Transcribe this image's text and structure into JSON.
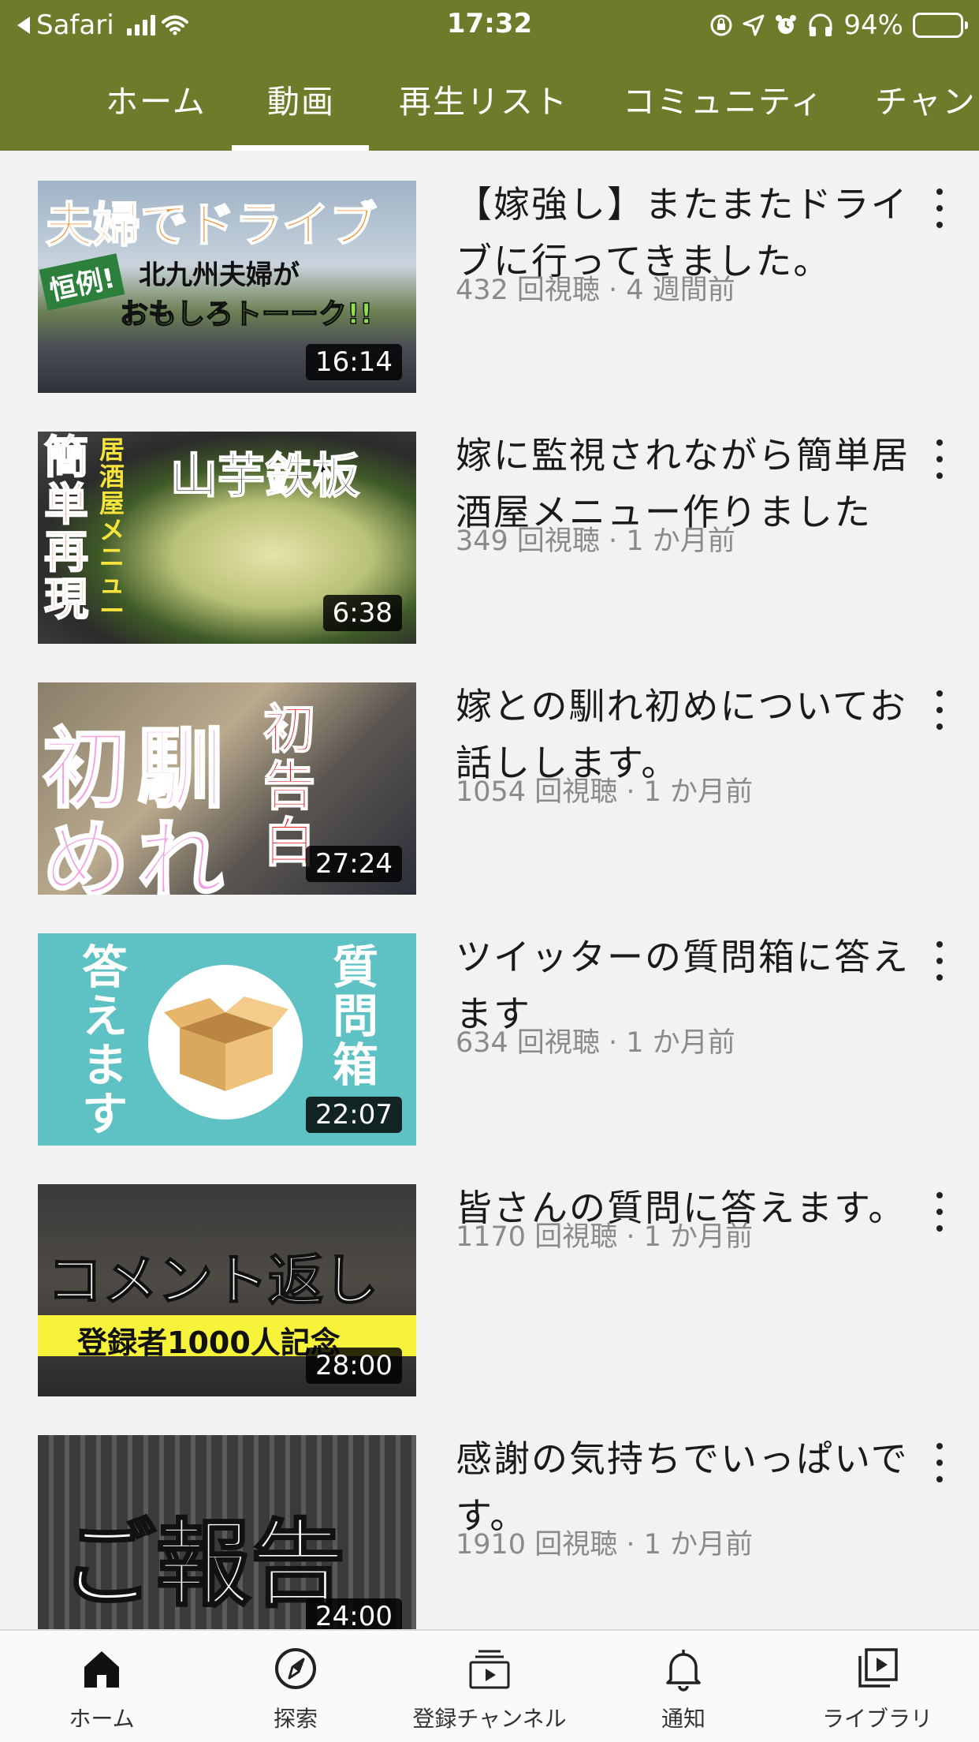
{
  "status_bar": {
    "back_app": "Safari",
    "time": "17:32",
    "battery": "94%"
  },
  "tabs": [
    {
      "label": "ホーム"
    },
    {
      "label": "動画"
    },
    {
      "label": "再生リスト"
    },
    {
      "label": "コミュニティ"
    },
    {
      "label": "チャン"
    }
  ],
  "videos": [
    {
      "title": "【嫁強し】またまたドライブに行ってきました。",
      "meta": "432 回視聴 · 4 週間前",
      "duration": "16:14",
      "thumb_text": [
        "夫婦でドライブ",
        "恒例!",
        "北九州夫婦が",
        "おもしろトーーク!!"
      ]
    },
    {
      "title": "嫁に監視されながら簡単居酒屋メニュー作りました",
      "meta": "349 回視聴 · 1 か月前",
      "duration": "6:38",
      "thumb_text": [
        "簡単再現",
        "居酒屋メニュー",
        "山芋鉄板"
      ]
    },
    {
      "title": "嫁との馴れ初めについてお話しします。",
      "meta": "1054 回視聴 · 1 か月前",
      "duration": "27:24",
      "thumb_text": [
        "馴",
        "初",
        "れ",
        "め",
        "初告白"
      ]
    },
    {
      "title": "ツイッターの質問箱に答えます",
      "meta": "634 回視聴 · 1 か月前",
      "duration": "22:07",
      "thumb_text": [
        "答えます",
        "質問箱"
      ]
    },
    {
      "title": "皆さんの質問に答えます。",
      "meta": "1170 回視聴 · 1 か月前",
      "duration": "28:00",
      "thumb_text": [
        "コメント返し",
        "登録者1000人記念"
      ]
    },
    {
      "title": "感謝の気持ちでいっぱいです。",
      "meta": "1910 回視聴 · 1 か月前",
      "duration": "24:00",
      "thumb_text": [
        "ご報告"
      ]
    }
  ],
  "bottom_nav": [
    {
      "label": "ホーム",
      "icon": "home-icon"
    },
    {
      "label": "探索",
      "icon": "compass-icon"
    },
    {
      "label": "登録チャンネル",
      "icon": "subscriptions-icon"
    },
    {
      "label": "通知",
      "icon": "bell-icon"
    },
    {
      "label": "ライブラリ",
      "icon": "library-icon"
    }
  ],
  "colors": {
    "header_bg": "#6f7b2b",
    "page_bg": "#f2f2f2"
  }
}
